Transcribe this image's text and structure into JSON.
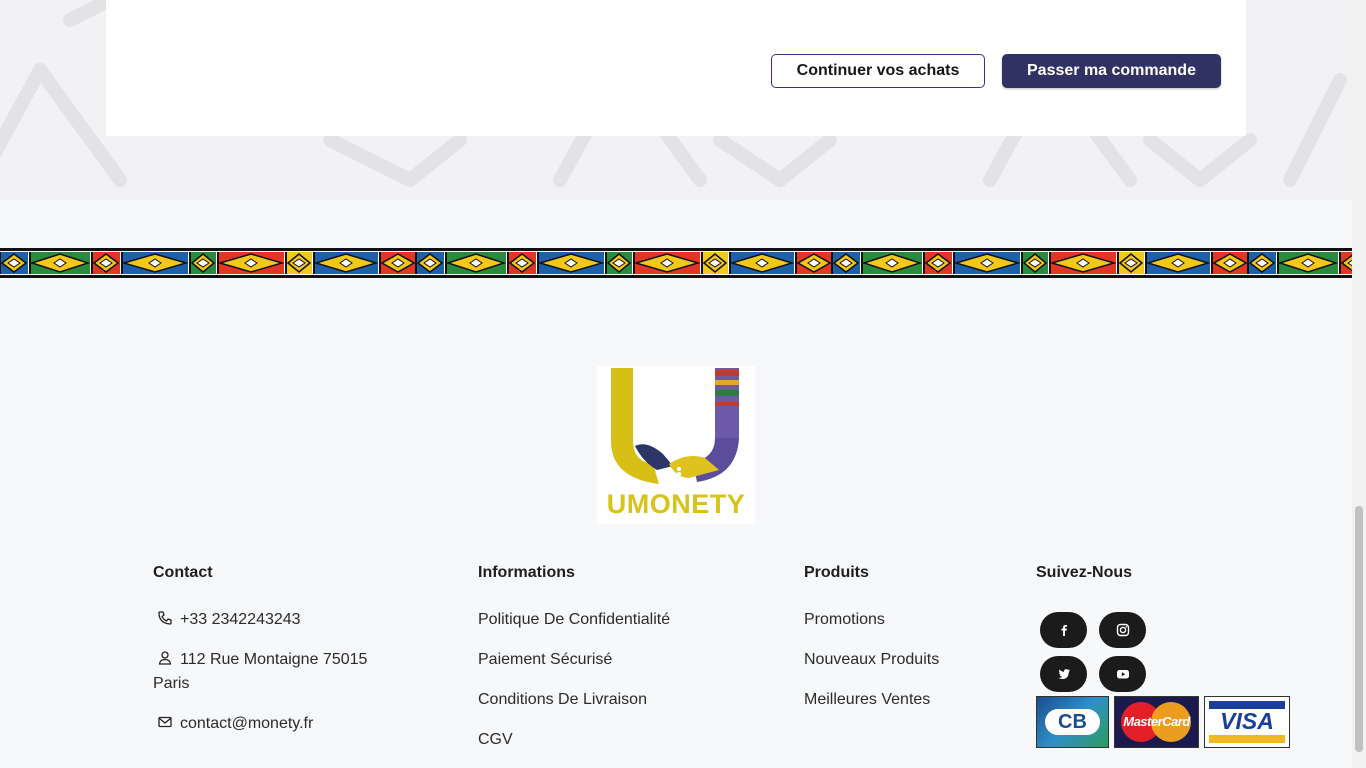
{
  "cart_actions": {
    "continue_label": "Continuer vos achats",
    "checkout_label": "Passer ma commande"
  },
  "brand": {
    "logo_text": "UMONETY"
  },
  "footer": {
    "contact": {
      "title": "Contact",
      "phone": "+33 2342243243",
      "address_line1": "112 Rue Montaigne 75015",
      "address_line2": "Paris",
      "email": "contact@monety.fr"
    },
    "informations": {
      "title": "Informations",
      "links": [
        "Politique De Confidentialité",
        "Paiement Sécurisé",
        "Conditions De Livraison",
        "CGV"
      ]
    },
    "produits": {
      "title": "Produits",
      "links": [
        "Promotions",
        "Nouveaux Produits",
        "Meilleures Ventes"
      ]
    },
    "suivez": {
      "title": "Suivez-Nous",
      "socials": [
        "facebook-icon",
        "instagram-icon",
        "twitter-icon",
        "youtube-icon"
      ],
      "payments": [
        "CB",
        "MasterCard",
        "VISA"
      ]
    }
  },
  "colors": {
    "primary": "#2f3263",
    "outline": "#3b2f8f",
    "logo_gold": "#d9c21a"
  }
}
